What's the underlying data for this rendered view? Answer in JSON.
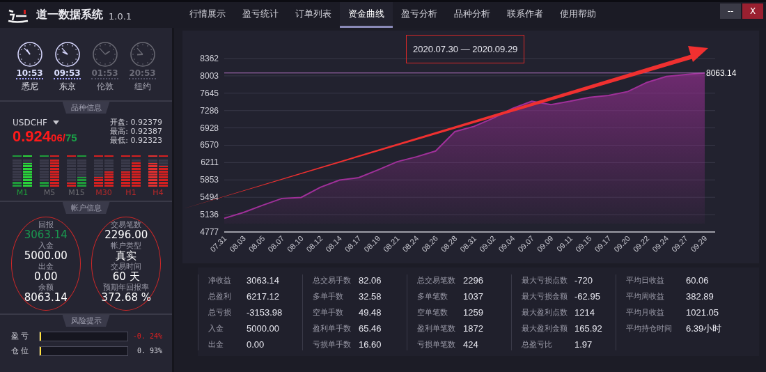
{
  "app": {
    "title": "道一数据系统",
    "version": "1.0.1"
  },
  "nav": [
    {
      "label": "行情展示",
      "selected": false
    },
    {
      "label": "盈亏统计",
      "selected": false
    },
    {
      "label": "订单列表",
      "selected": false
    },
    {
      "label": "资金曲线",
      "selected": true
    },
    {
      "label": "盈亏分析",
      "selected": false
    },
    {
      "label": "品种分析",
      "selected": false
    },
    {
      "label": "联系作者",
      "selected": false
    },
    {
      "label": "使用帮助",
      "selected": false
    }
  ],
  "window_buttons": [
    {
      "kind": "minimize",
      "label": "--"
    },
    {
      "kind": "close",
      "label": "X"
    }
  ],
  "clocks": [
    {
      "time": "10:53",
      "city": "悉尼",
      "active": true
    },
    {
      "time": "09:53",
      "city": "东京",
      "active": true
    },
    {
      "time": "01:53",
      "city": "伦敦",
      "active": false
    },
    {
      "time": "20:53",
      "city": "纽约",
      "active": false
    }
  ],
  "symbol_panel": {
    "heading": "品种信息",
    "symbol": "USDCHF",
    "price_main": "0.924",
    "price_mid": "06",
    "price_sep": "/",
    "price_end": "75",
    "quotes": [
      {
        "label": "开盘:",
        "value": "0.92379"
      },
      {
        "label": "最高:",
        "value": "0.92387"
      },
      {
        "label": "最低:",
        "value": "0.92323"
      }
    ],
    "timeframes": [
      {
        "label": "M1",
        "color": "#1f9a3a",
        "meters": [
          {
            "level": 0.2,
            "color": "#1f9a3a"
          },
          {
            "level": 0.85,
            "color": "#2ad43a"
          }
        ]
      },
      {
        "label": "M5",
        "color": "#6a6a70",
        "meters": [
          {
            "level": 0.2,
            "color": "#1f9a3a"
          },
          {
            "level": 1,
            "color": "#d42020"
          }
        ]
      },
      {
        "label": "M15",
        "color": "#6a6a70",
        "meters": [
          {
            "level": 0.15,
            "color": "#d42020"
          },
          {
            "level": 0.35,
            "color": "#1f9a3a"
          }
        ]
      },
      {
        "label": "M30",
        "color": "#b02a2a",
        "meters": [
          {
            "level": 0.35,
            "color": "#d42020"
          },
          {
            "level": 0.55,
            "color": "#d42020"
          }
        ]
      },
      {
        "label": "H1",
        "color": "#c02828",
        "meters": [
          {
            "level": 0.55,
            "color": "#d42020"
          },
          {
            "level": 0.9,
            "color": "#d42020"
          }
        ]
      },
      {
        "label": "H4",
        "color": "#c02828",
        "meters": [
          {
            "level": 0.85,
            "color": "#e03030"
          },
          {
            "level": 0.75,
            "color": "#d42020"
          }
        ]
      }
    ]
  },
  "account_panel": {
    "heading": "帐户信息",
    "columns": [
      [
        {
          "label": "回报",
          "value": "3063.14",
          "color": "#1a9a50"
        },
        {
          "label": "入金",
          "value": "5000.00",
          "color": "#ffffff"
        },
        {
          "label": "出金",
          "value": "0.00",
          "color": "#ffffff"
        },
        {
          "label": "余额",
          "value": "8063.14",
          "color": "#ffffff"
        }
      ],
      [
        {
          "label": "交易笔数",
          "value": "2296.00",
          "color": "#ffffff"
        },
        {
          "label": "帐户类型",
          "value": "真实",
          "color": "#ffffff"
        },
        {
          "label": "交易时间",
          "value": "60 天",
          "color": "#ffffff"
        },
        {
          "label": "预期年回报率",
          "value": "372.68 %",
          "color": "#ffffff"
        }
      ]
    ]
  },
  "risk_panel": {
    "heading": "风险提示",
    "rows": [
      {
        "label": "盈 亏",
        "level": 0.01,
        "reading": "-0. 24%",
        "color": "#e02020"
      },
      {
        "label": "仓 位",
        "level": 0.01,
        "reading": "0. 93%",
        "color": "#d8d8e0"
      }
    ]
  },
  "chart": {
    "date_range": "2020.07.30 — 2020.09.29",
    "last_value": "8063.14",
    "chart_data": {
      "type": "area",
      "grid": true,
      "categories": [
        "07.31",
        "08.03",
        "08.05",
        "08.07",
        "08.10",
        "08.12",
        "08.14",
        "08.17",
        "08.19",
        "08.21",
        "08.24",
        "08.26",
        "08.28",
        "08.31",
        "09.02",
        "09.04",
        "09.07",
        "09.09",
        "09.11",
        "09.15",
        "09.17",
        "09.20",
        "09.22",
        "09.24",
        "09.27",
        "09.29"
      ],
      "series": [
        {
          "color": "#a0309a",
          "values": [
            5060,
            5180,
            5330,
            5470,
            5490,
            5700,
            5850,
            5900,
            6060,
            6230,
            6330,
            6450,
            6850,
            6960,
            7130,
            7330,
            7480,
            7410,
            7480,
            7560,
            7600,
            7680,
            7870,
            7990,
            8030,
            8063
          ]
        }
      ],
      "ylim": [
        4777,
        8362
      ],
      "yticks": [
        4777,
        5136,
        5494,
        5853,
        6211,
        6570,
        6928,
        7286,
        7645,
        8003,
        8362
      ]
    }
  },
  "stats": [
    [
      {
        "label": "净收益",
        "value": "3063.14"
      },
      {
        "label": "总盈利",
        "value": "6217.12"
      },
      {
        "label": "总亏损",
        "value": "-3153.98"
      },
      {
        "label": "入金",
        "value": "5000.00"
      },
      {
        "label": "出金",
        "value": "0.00"
      }
    ],
    [
      {
        "label": "总交易手数",
        "value": "82.06"
      },
      {
        "label": "多单手数",
        "value": "32.58"
      },
      {
        "label": "空单手数",
        "value": "49.48"
      },
      {
        "label": "盈利单手数",
        "value": "65.46"
      },
      {
        "label": "亏损单手数",
        "value": "16.60"
      }
    ],
    [
      {
        "label": "总交易笔数",
        "value": "2296"
      },
      {
        "label": "多单笔数",
        "value": "1037"
      },
      {
        "label": "空单笔数",
        "value": "1259"
      },
      {
        "label": "盈利单笔数",
        "value": "1872"
      },
      {
        "label": "亏损单笔数",
        "value": "424"
      }
    ],
    [
      {
        "label": "最大亏损点数",
        "value": "-720"
      },
      {
        "label": "最大亏损金额",
        "value": "-62.95"
      },
      {
        "label": "最大盈利点数",
        "value": "1214"
      },
      {
        "label": "最大盈利金额",
        "value": "165.92"
      },
      {
        "label": "总盈亏比",
        "value": "1.97"
      }
    ],
    [
      {
        "label": "平均日收益",
        "value": "60.06"
      },
      {
        "label": "平均周收益",
        "value": "382.89"
      },
      {
        "label": "平均月收益",
        "value": "1021.05"
      },
      {
        "label": "平均持仓时间",
        "value": "6.39小时"
      }
    ]
  ]
}
